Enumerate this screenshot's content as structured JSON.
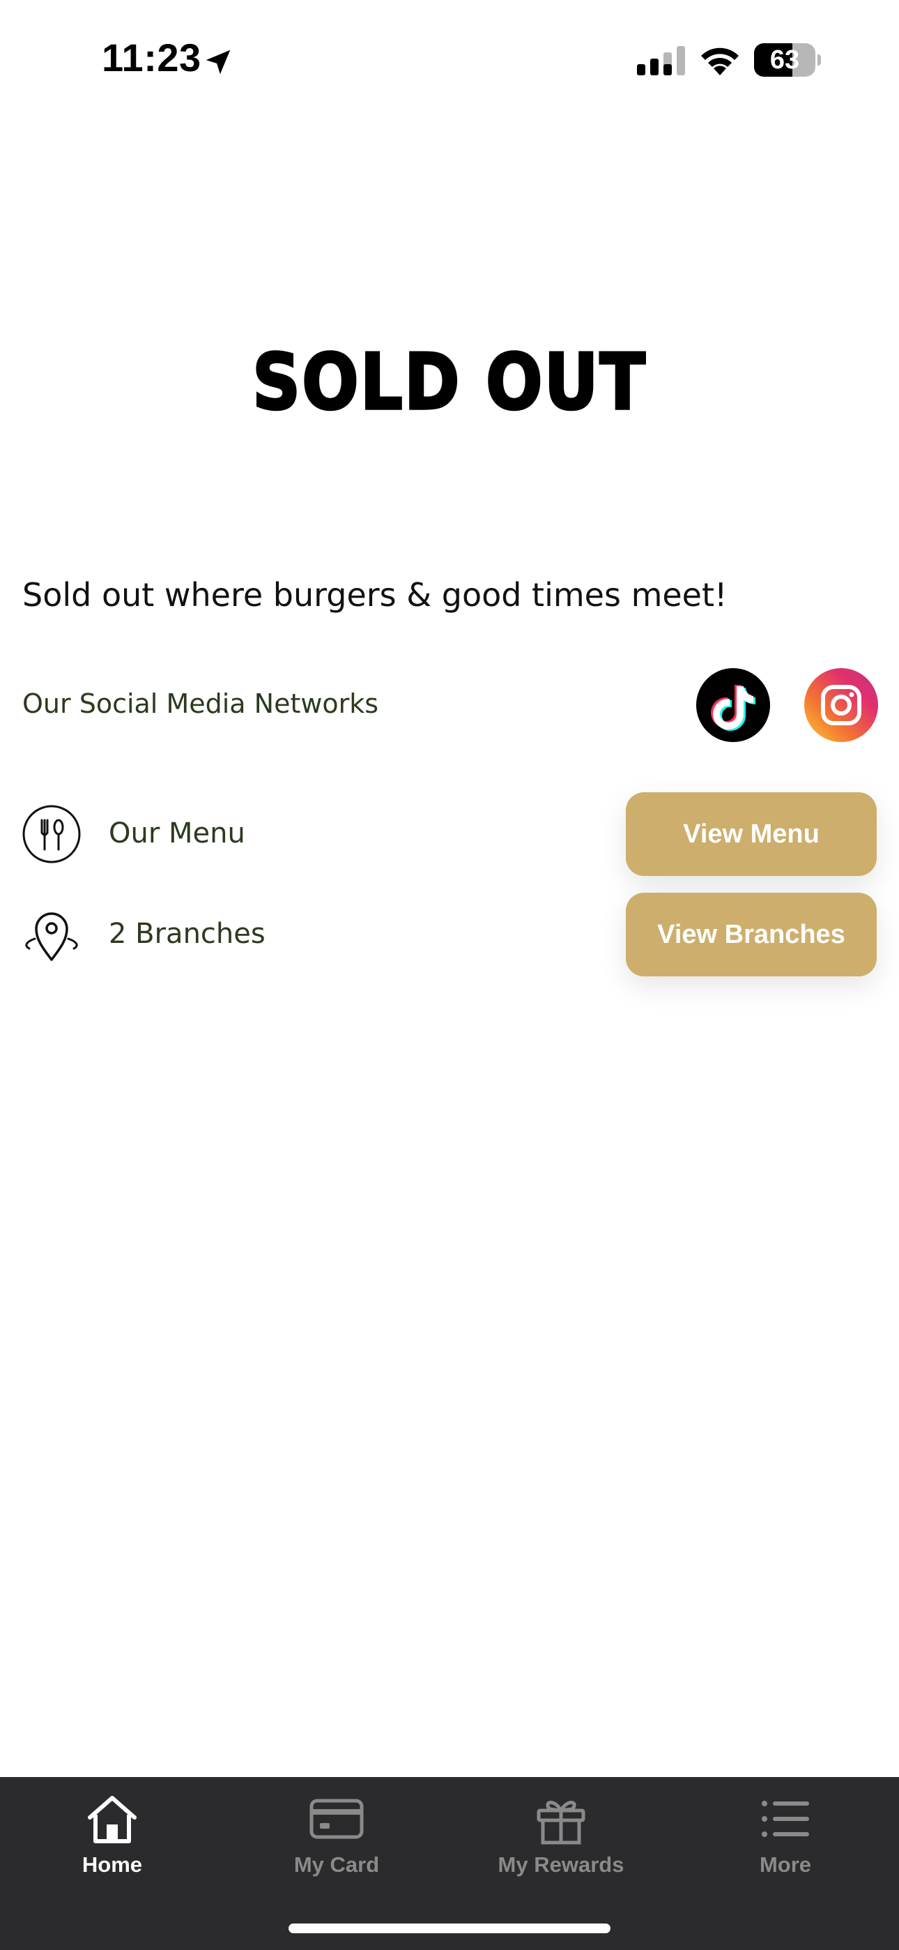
{
  "status_bar": {
    "time": "11:23",
    "battery": "63",
    "battery_level": 0.63
  },
  "brand": {
    "logo_text": "SOLD OUT",
    "tagline": "Sold out where burgers & good times meet!"
  },
  "social": {
    "label": "Our Social Media Networks",
    "networks": [
      "tiktok-icon",
      "instagram-icon"
    ]
  },
  "menu_row": {
    "label": "Our Menu",
    "button": "View Menu",
    "icon": "cutlery-icon"
  },
  "branches_row": {
    "label": "2 Branches",
    "button": "View Branches",
    "icon": "location-pin-icon"
  },
  "tabs": [
    {
      "label": "Home",
      "icon": "home-icon",
      "active": true
    },
    {
      "label": "My Card",
      "icon": "card-icon",
      "active": false
    },
    {
      "label": "My Rewards",
      "icon": "gift-icon",
      "active": false
    },
    {
      "label": "More",
      "icon": "list-icon",
      "active": false
    }
  ],
  "colors": {
    "accent": "#cdae6c",
    "tab_bar": "#2b2a2c",
    "label_text": "#2c3a1f"
  }
}
